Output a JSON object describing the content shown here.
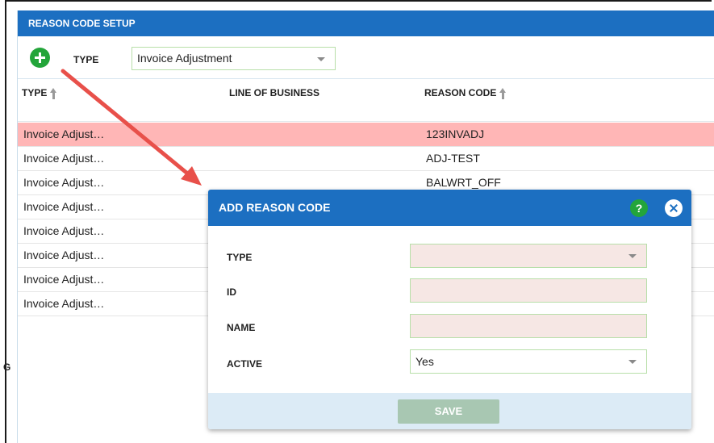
{
  "left_fragment": "G",
  "panel": {
    "title": "REASON CODE SETUP"
  },
  "toolbar": {
    "type_label": "TYPE",
    "type_value": "Invoice Adjustment"
  },
  "grid": {
    "columns": [
      "TYPE",
      "LINE OF BUSINESS",
      "REASON CODE"
    ],
    "rows": [
      {
        "type": "Invoice Adjust…",
        "lob": "",
        "code": "123INVADJ"
      },
      {
        "type": "Invoice Adjust…",
        "lob": "",
        "code": "ADJ-TEST"
      },
      {
        "type": "Invoice Adjust…",
        "lob": "",
        "code": "BALWRT_OFF"
      },
      {
        "type": "Invoice Adjust…",
        "lob": "",
        "code": ""
      },
      {
        "type": "Invoice Adjust…",
        "lob": "",
        "code": ""
      },
      {
        "type": "Invoice Adjust…",
        "lob": "",
        "code": ""
      },
      {
        "type": "Invoice Adjust…",
        "lob": "",
        "code": ""
      },
      {
        "type": "Invoice Adjust…",
        "lob": "",
        "code": ""
      }
    ]
  },
  "modal": {
    "title": "ADD REASON CODE",
    "help_glyph": "?",
    "fields": {
      "type_label": "TYPE",
      "id_label": "ID",
      "name_label": "NAME",
      "active_label": "ACTIVE",
      "active_value": "Yes"
    },
    "save_label": "SAVE"
  },
  "colors": {
    "header_blue": "#1c6fc1",
    "selected_row": "#ffb6b6",
    "add_green": "#23a53a",
    "annotation_arrow": "#e8504a"
  }
}
